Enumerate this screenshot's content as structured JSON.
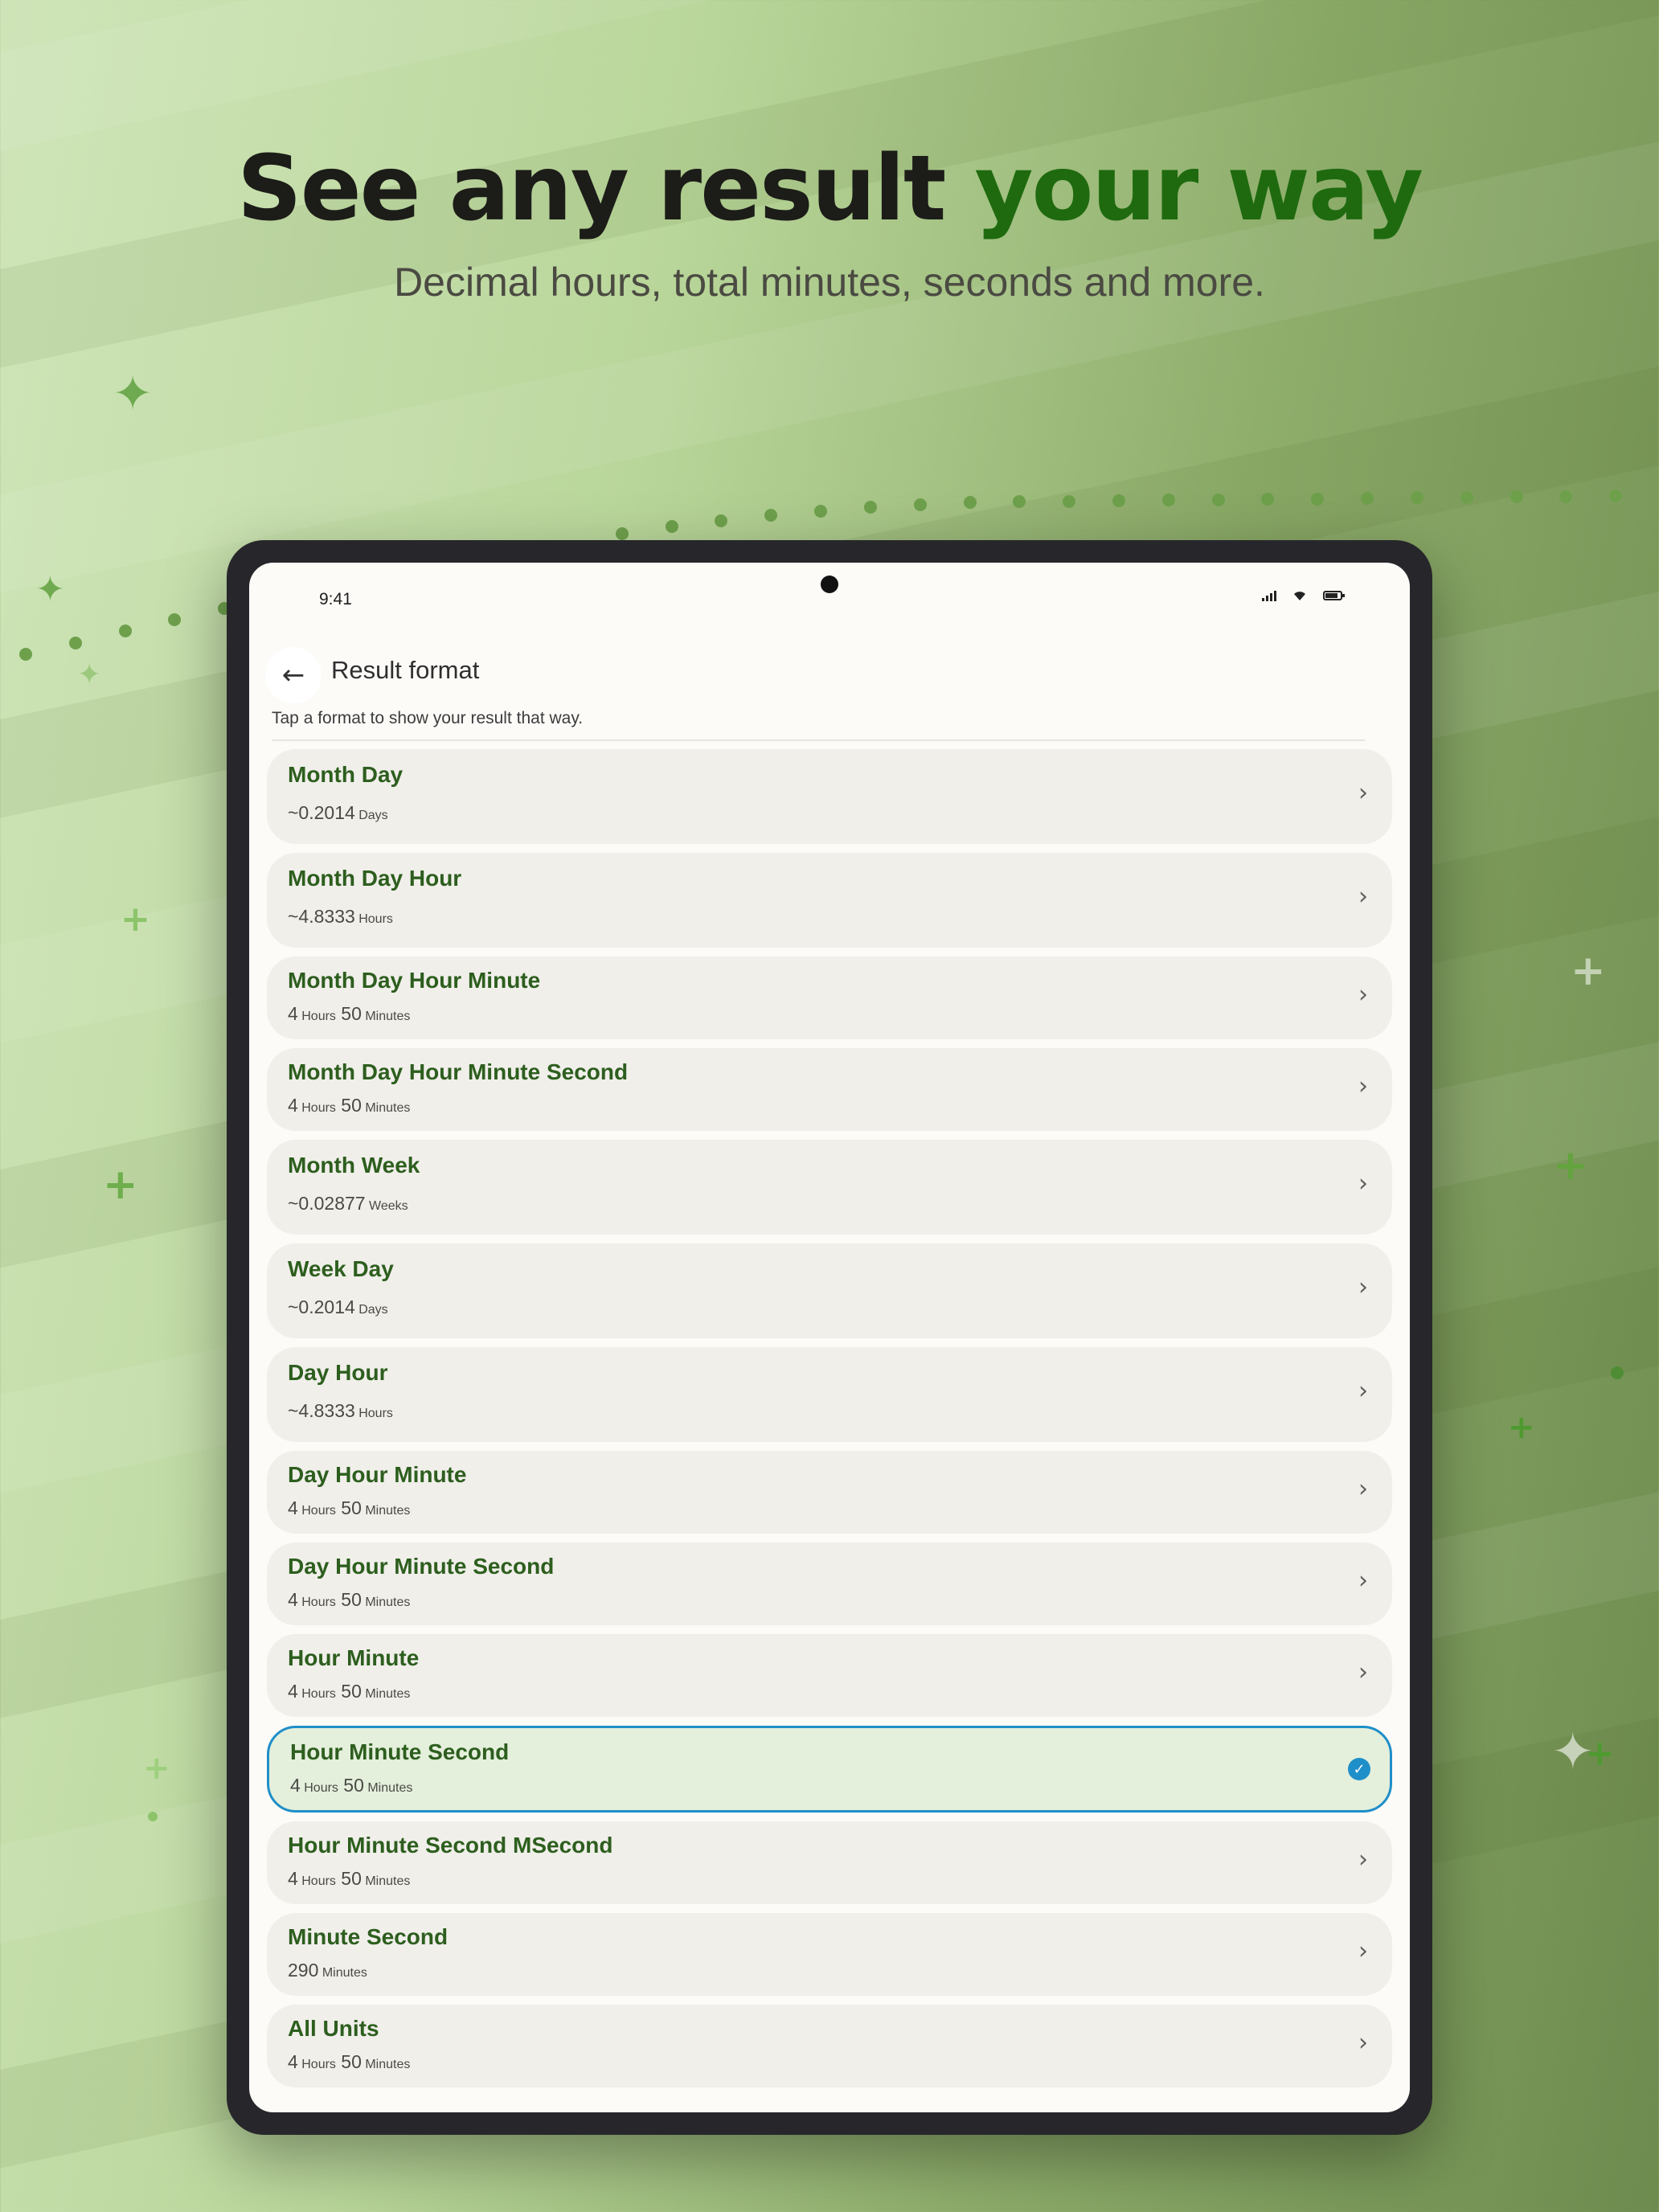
{
  "hero": {
    "headline_part1": "See any result ",
    "headline_part2": "your way",
    "subheadline": "Decimal hours, total minutes, seconds and more."
  },
  "status_bar": {
    "time": "9:41"
  },
  "appbar": {
    "back_icon": "arrow-left-icon",
    "title": "Result format"
  },
  "hint": "Tap a format to show your result that way.",
  "formats": [
    {
      "name": "Month Day",
      "value": "~0.2014",
      "unit": "Days"
    },
    {
      "name": "Month Day Hour",
      "value": "~4.8333",
      "unit": "Hours"
    },
    {
      "name": "Month Day Hour Minute",
      "value": "4",
      "unit": "Hours",
      "value2": "50",
      "unit2": "Minutes"
    },
    {
      "name": "Month Day Hour Minute Second",
      "value": "4",
      "unit": "Hours",
      "value2": "50",
      "unit2": "Minutes"
    },
    {
      "name": "Month Week",
      "value": "~0.02877",
      "unit": "Weeks"
    },
    {
      "name": "Week Day",
      "value": "~0.2014",
      "unit": "Days"
    },
    {
      "name": "Day Hour",
      "value": "~4.8333",
      "unit": "Hours"
    },
    {
      "name": "Day Hour Minute",
      "value": "4",
      "unit": "Hours",
      "value2": "50",
      "unit2": "Minutes"
    },
    {
      "name": "Day Hour Minute Second",
      "value": "4",
      "unit": "Hours",
      "value2": "50",
      "unit2": "Minutes"
    },
    {
      "name": "Hour Minute",
      "value": "4",
      "unit": "Hours",
      "value2": "50",
      "unit2": "Minutes"
    },
    {
      "name": "Hour Minute Second",
      "value": "4",
      "unit": "Hours",
      "value2": "50",
      "unit2": "Minutes",
      "selected": true
    },
    {
      "name": "Hour Minute Second MSecond",
      "value": "4",
      "unit": "Hours",
      "value2": "50",
      "unit2": "Minutes"
    },
    {
      "name": "Minute Second",
      "value": "290",
      "unit": "Minutes"
    },
    {
      "name": "All Units",
      "value": "4",
      "unit": "Hours",
      "value2": "50",
      "unit2": "Minutes"
    }
  ],
  "colors": {
    "accent_green": "#1f6a0f",
    "item_title": "#2d5e1e",
    "selected_border": "#1f8fc9",
    "selected_bg": "#e4efdc"
  }
}
